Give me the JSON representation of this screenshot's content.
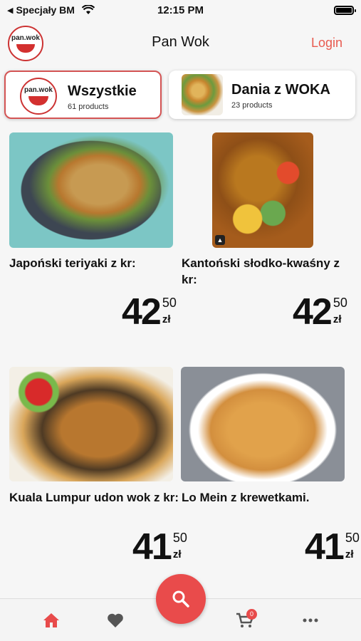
{
  "status_bar": {
    "back_label": "Specjały BM",
    "time": "12:15 PM"
  },
  "header": {
    "logo_text": "pan.wok",
    "title": "Pan Wok",
    "login_label": "Login"
  },
  "categories": [
    {
      "title": "Wszystkie",
      "count": "61 products",
      "icon": "pan-wok-logo",
      "selected": true
    },
    {
      "title": "Dania z WOKA",
      "count": "23 products",
      "icon": "noodles-thumbnail",
      "selected": false
    }
  ],
  "products": [
    {
      "name": "Japoński teriyaki z kr:",
      "price_int": "42",
      "price_frac": "50",
      "currency": "zł"
    },
    {
      "name": "Kantoński słodko-kwaśny z kr:",
      "price_int": "42",
      "price_frac": "50",
      "currency": "zł"
    },
    {
      "name": "Kuala Lumpur udon wok z kr:",
      "price_int": "41",
      "price_frac": "50",
      "currency": "zł"
    },
    {
      "name": "Lo Mein z krewetkami.",
      "price_int": "41",
      "price_frac": "50",
      "currency": "zł"
    }
  ],
  "nav": {
    "cart_count": "0",
    "items": [
      "home-icon",
      "heart-icon",
      "search-icon",
      "cart-icon",
      "more-icon"
    ]
  },
  "colors": {
    "accent": "#e94b4b",
    "login": "#e85a4f",
    "selected_border": "#d45454"
  }
}
